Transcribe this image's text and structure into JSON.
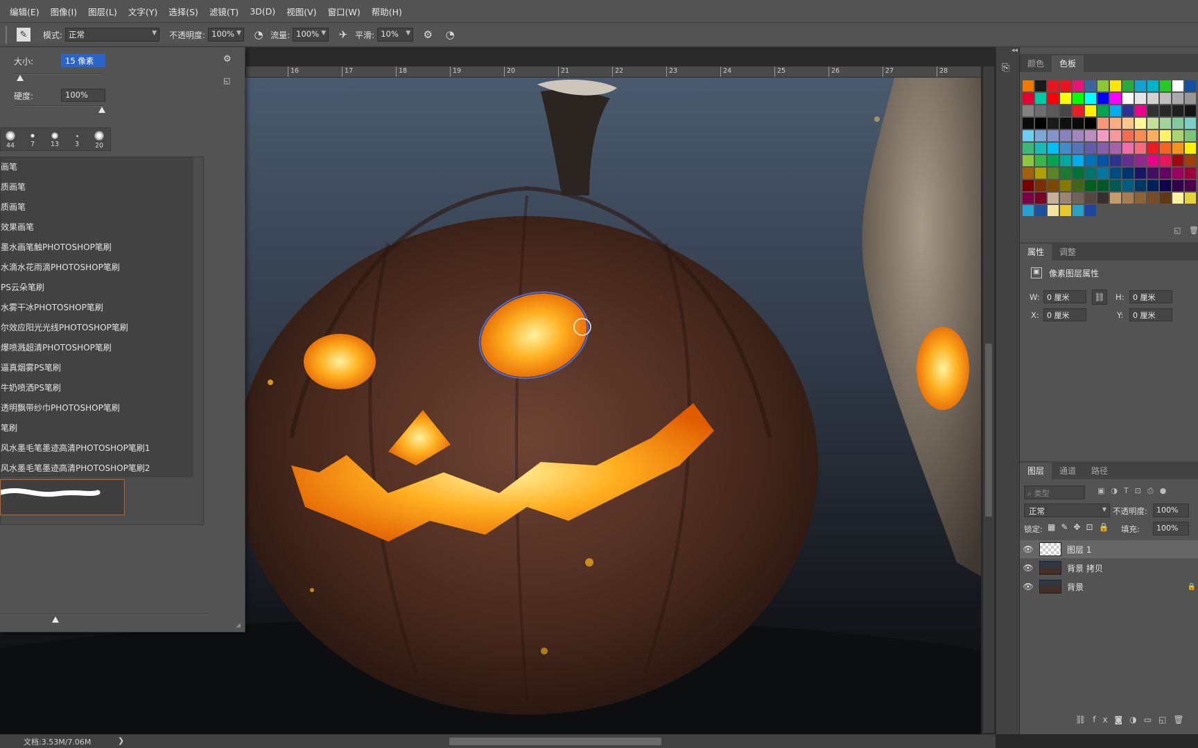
{
  "menu": [
    "编辑(E)",
    "图像(I)",
    "图层(L)",
    "文字(Y)",
    "选择(S)",
    "滤镜(T)",
    "3D(D)",
    "视图(V)",
    "窗口(W)",
    "帮助(H)"
  ],
  "options": {
    "mode_label": "模式:",
    "mode_value": "正常",
    "opacity_label": "不透明度:",
    "opacity_value": "100%",
    "flow_label": "流量:",
    "flow_value": "100%",
    "smoothing_label": "平滑:",
    "smoothing_value": "10%"
  },
  "brush_panel": {
    "size_label": "大小:",
    "size_value": "15 像素",
    "hardness_label": "硬度:",
    "hardness_value": "100%",
    "tips": [
      "44",
      "7",
      "13",
      "3",
      "20"
    ],
    "brushes": [
      "画笔",
      "质画笔",
      "质画笔",
      "效果画笔",
      "墨水画笔触PHOTOSHOP笔刷",
      "水滴水花雨滴PHOTOSHOP笔刷",
      "PS云朵笔刷",
      "水雾干冰PHOTOSHOP笔刷",
      "尔效应阳光光线PHOTOSHOP笔刷",
      "爆喷溅超清PHOTOSHOP笔刷",
      "逼真烟雾PS笔刷",
      "牛奶喷洒PS笔刷",
      "透明飘带纱巾PHOTOSHOP笔刷",
      "笔刷",
      "风水墨毛笔墨迹高清PHOTOSHOP笔刷1",
      "风水墨毛笔墨迹高清PHOTOSHOP笔刷2"
    ]
  },
  "ruler": [
    "16",
    "17",
    "18",
    "19",
    "20",
    "21",
    "22",
    "23",
    "24",
    "25",
    "26",
    "27",
    "28"
  ],
  "swatches_panel": {
    "tabs": [
      "颜色",
      "色板"
    ],
    "colors": [
      "#f07800",
      "#1a1a1a",
      "#e8141e",
      "#e8141e",
      "#e81478",
      "#3c64a0",
      "#8cc832",
      "#ffe600",
      "#28aa3c",
      "#14a0d2",
      "#00b4c8",
      "#28c828",
      "#ffffff",
      "#1450a0",
      "#e60032",
      "#00c8a0",
      "#ff0000",
      "#ffff00",
      "#00ff00",
      "#00ffff",
      "#0000ff",
      "#ff00ff",
      "#ffffff",
      "#e6e6e6",
      "#d2d2d2",
      "#bebebe",
      "#aaaaaa",
      "#969696",
      "#828282",
      "#6e6e6e",
      "#5a5a5a",
      "#464646",
      "#ed1c24",
      "#fff200",
      "#00a651",
      "#00aeef",
      "#2e3192",
      "#ec008c",
      "#323232",
      "#282828",
      "#1e1e1e",
      "#141414",
      "#0a0a0a",
      "#000000",
      "#1a1a1a",
      "#101010",
      "#0a0a0a",
      "#000000",
      "#f7977a",
      "#f9ad81",
      "#fdc68a",
      "#fff79a",
      "#c4df9b",
      "#a3d39c",
      "#82ca9d",
      "#7bcdc8",
      "#6ecff6",
      "#7ea7d8",
      "#8493ca",
      "#8882be",
      "#a187be",
      "#bc8dbf",
      "#f49ac2",
      "#f6989d",
      "#f26c4f",
      "#f68e55",
      "#fbaf5c",
      "#fff467",
      "#acd372",
      "#7cc576",
      "#3bb878",
      "#1abbb4",
      "#00bff3",
      "#438ccb",
      "#5574b9",
      "#605ca8",
      "#855fa8",
      "#a763a8",
      "#f06ea9",
      "#f26d7d",
      "#ed1c24",
      "#f26522",
      "#f7941d",
      "#fff200",
      "#8dc73f",
      "#39b54a",
      "#00a651",
      "#00a99d",
      "#00aeef",
      "#0072bc",
      "#0054a6",
      "#2e3192",
      "#662d91",
      "#92278f",
      "#ec008c",
      "#ed145b",
      "#9e0b0f",
      "#a0410d",
      "#a36209",
      "#aba000",
      "#598527",
      "#1a7b30",
      "#007236",
      "#00746b",
      "#0076a3",
      "#004b80",
      "#003471",
      "#1b1464",
      "#440e62",
      "#630460",
      "#9e005d",
      "#9e0039",
      "#790000",
      "#7b2e00",
      "#7d4900",
      "#827b00",
      "#406618",
      "#005e20",
      "#005826",
      "#005952",
      "#005b7f",
      "#003663",
      "#002157",
      "#0d004c",
      "#32004b",
      "#4b0049",
      "#7b0046",
      "#7a0026",
      "#c7b299",
      "#998675",
      "#736357",
      "#534741",
      "#37302d",
      "#c69c6d",
      "#a67c52",
      "#8c6239",
      "#754c24",
      "#603913",
      "#fff3a0",
      "#e6d23c",
      "#28a0d2",
      "#1e50a0",
      "#f0e6a0",
      "#e6c828",
      "#28a0c8",
      "#1e46a0"
    ]
  },
  "properties_panel": {
    "tabs": [
      "属性",
      "调整"
    ],
    "title": "像素图层属性",
    "w_label": "W:",
    "w_value": "0 厘米",
    "h_label": "H:",
    "h_value": "0 厘米",
    "x_label": "X:",
    "x_value": "0 厘米",
    "y_label": "Y:",
    "y_value": "0 厘米"
  },
  "layers_panel": {
    "tabs": [
      "图层",
      "通道",
      "路径"
    ],
    "filter_placeholder": "类型",
    "blend_mode": "正常",
    "opacity_label": "不透明度:",
    "opacity_value": "100%",
    "lock_label": "锁定:",
    "fill_label": "填充:",
    "fill_value": "100%",
    "layers": [
      {
        "name": "图层 1",
        "selected": true,
        "locked": false
      },
      {
        "name": "背景 拷贝",
        "selected": false,
        "locked": false
      },
      {
        "name": "背景",
        "selected": false,
        "locked": true
      }
    ]
  },
  "status": {
    "doc_info": "文档:3.53M/7.06M"
  }
}
